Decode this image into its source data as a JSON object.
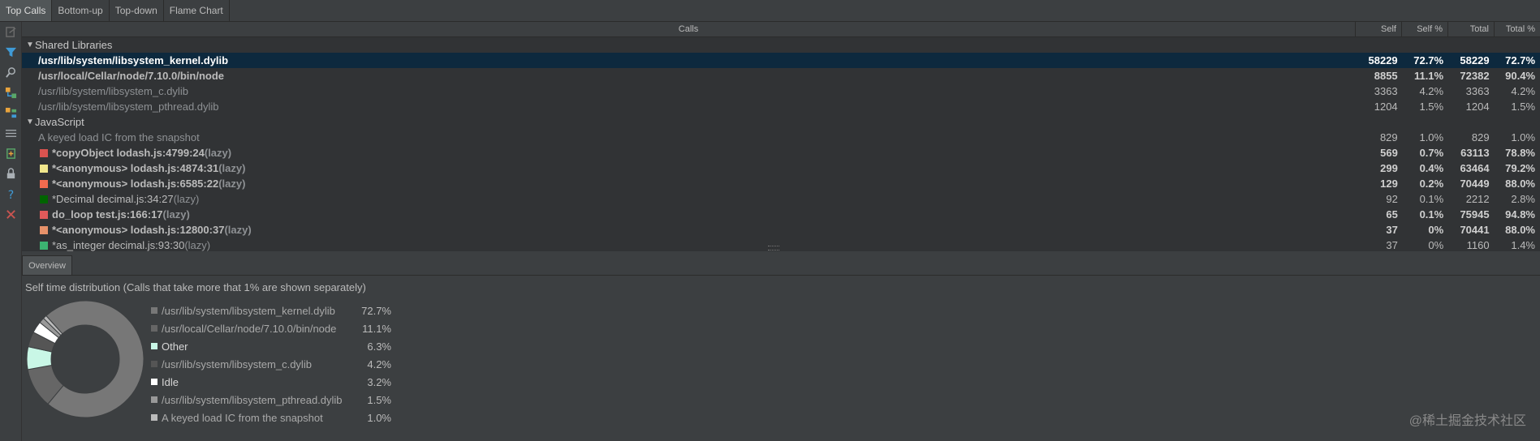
{
  "tabs": [
    {
      "label": "Top Calls",
      "active": true
    },
    {
      "label": "Bottom-up",
      "active": false
    },
    {
      "label": "Top-down",
      "active": false
    },
    {
      "label": "Flame Chart",
      "active": false
    }
  ],
  "toolstrip_icons": [
    "export-icon",
    "filter-icon",
    "find-icon",
    "expand-icon",
    "collapse-icon",
    "merge-icon",
    "navigate-icon",
    "lock-icon",
    "help-icon",
    "close-icon"
  ],
  "table": {
    "headers": {
      "calls": "Calls",
      "self": "Self",
      "self_pct": "Self %",
      "total": "Total",
      "total_pct": "Total %"
    },
    "groups": [
      {
        "name": "Shared Libraries",
        "rows": [
          {
            "name": "/usr/lib/system/libsystem_kernel.dylib",
            "self": "58229",
            "self_pct": "72.7%",
            "total": "58229",
            "total_pct": "72.7%",
            "bold": true,
            "selected": true
          },
          {
            "name": "/usr/local/Cellar/node/7.10.0/bin/node",
            "self": "8855",
            "self_pct": "11.1%",
            "total": "72382",
            "total_pct": "90.4%",
            "bold": true
          },
          {
            "name": "/usr/lib/system/libsystem_c.dylib",
            "self": "3363",
            "self_pct": "4.2%",
            "total": "3363",
            "total_pct": "4.2%"
          },
          {
            "name": "/usr/lib/system/libsystem_pthread.dylib",
            "self": "1204",
            "self_pct": "1.5%",
            "total": "1204",
            "total_pct": "1.5%"
          }
        ]
      },
      {
        "name": "JavaScript",
        "rows": [
          {
            "name": "A keyed load IC from the snapshot",
            "self": "829",
            "self_pct": "1.0%",
            "total": "829",
            "total_pct": "1.0%"
          },
          {
            "name": "*copyObject lodash.js:4799:24",
            "suffix": "(lazy)",
            "color": "#d9534f",
            "self": "569",
            "self_pct": "0.7%",
            "total": "63113",
            "total_pct": "78.8%",
            "bold": true
          },
          {
            "name": "*<anonymous> lodash.js:4874:31",
            "suffix": "(lazy)",
            "color": "#f0e68c",
            "self": "299",
            "self_pct": "0.4%",
            "total": "63464",
            "total_pct": "79.2%",
            "bold": true
          },
          {
            "name": "*<anonymous> lodash.js:6585:22",
            "suffix": "(lazy)",
            "color": "#f26b4f",
            "self": "129",
            "self_pct": "0.2%",
            "total": "70449",
            "total_pct": "88.0%",
            "bold": true
          },
          {
            "name": "*Decimal decimal.js:34:27",
            "suffix": "(lazy)",
            "color": "#006400",
            "self": "92",
            "self_pct": "0.1%",
            "total": "2212",
            "total_pct": "2.8%"
          },
          {
            "name": "do_loop test.js:166:17",
            "suffix": "(lazy)",
            "color": "#e05a5a",
            "self": "65",
            "self_pct": "0.1%",
            "total": "75945",
            "total_pct": "94.8%",
            "bold": true
          },
          {
            "name": "*<anonymous> lodash.js:12800:37",
            "suffix": "(lazy)",
            "color": "#e8926a",
            "self": "37",
            "self_pct": "0%",
            "total": "70441",
            "total_pct": "88.0%",
            "bold": true
          },
          {
            "name": "*as_integer decimal.js:93:30",
            "suffix": "(lazy)",
            "color": "#3cb371",
            "self": "37",
            "self_pct": "0%",
            "total": "1160",
            "total_pct": "1.4%"
          }
        ]
      }
    ]
  },
  "overview": {
    "tab_label": "Overview",
    "title": "Self time distribution (Calls that take more that 1% are shown separately)",
    "legend": [
      {
        "label": "/usr/lib/system/libsystem_kernel.dylib",
        "pct": "72.7%",
        "value": 72.7,
        "color": "#777777"
      },
      {
        "label": "/usr/local/Cellar/node/7.10.0/bin/node",
        "pct": "11.1%",
        "value": 11.1,
        "color": "#666666"
      },
      {
        "label": "Other",
        "pct": "6.3%",
        "value": 6.3,
        "color": "#c9f7e6",
        "bright": true
      },
      {
        "label": "/usr/lib/system/libsystem_c.dylib",
        "pct": "4.2%",
        "value": 4.2,
        "color": "#555555"
      },
      {
        "label": "Idle",
        "pct": "3.2%",
        "value": 3.2,
        "color": "#ffffff",
        "bright": true
      },
      {
        "label": "/usr/lib/system/libsystem_pthread.dylib",
        "pct": "1.5%",
        "value": 1.5,
        "color": "#999999"
      },
      {
        "label": "A keyed load IC from the snapshot",
        "pct": "1.0%",
        "value": 1.0,
        "color": "#bbbbbb"
      }
    ]
  },
  "watermark": "@稀土掘金技术社区"
}
